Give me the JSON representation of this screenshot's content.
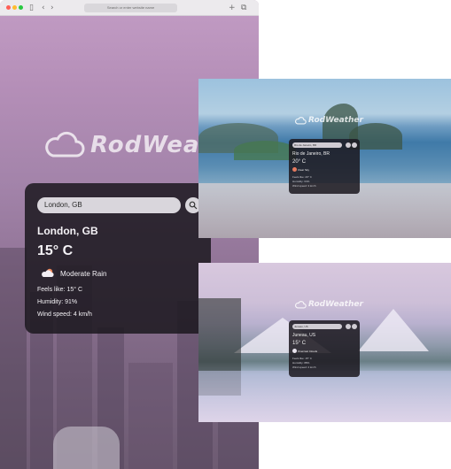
{
  "browser": {
    "url_text": "Search or enter website name",
    "back_icon": "chevron-left-icon",
    "forward_icon": "chevron-right-icon",
    "new_tab_icon": "plus-icon",
    "tabs_icon": "tabs-icon"
  },
  "brand": {
    "name": "RodWeather",
    "logo_icon": "cloud-logo-icon"
  },
  "main_card": {
    "search_value": "London, GB",
    "search_icon": "search-icon",
    "city": "London, GB",
    "temperature": "15° C",
    "description": "Moderate Rain",
    "weather_icon": "sun-cloud-rain-icon",
    "feels_like": "Feels like: 15° C",
    "humidity": "Humidity: 91%",
    "wind": "Wind speed: 4 km/h"
  },
  "rio_card": {
    "brand": "RodWeather",
    "search_value": "Rio de Janeiro, BR",
    "city": "Rio de Janeiro, BR",
    "temperature": "20° C",
    "description": "Clear Sky",
    "feels_like": "Feels like: 20° C",
    "humidity": "Humidity: 64%",
    "wind": "Wind speed: 3 km/h"
  },
  "mountain_card": {
    "brand": "RodWeather",
    "search_value": "Juneau, US",
    "city": "Juneau, US",
    "temperature": "15° C",
    "description": "Overcast Clouds",
    "feels_like": "Feels like: 15° C",
    "humidity": "Humidity: 88%",
    "wind": "Wind speed: 2 km/h"
  },
  "colors": {
    "card_bg": "#1c1820",
    "accent_purple": "#b58fb8",
    "search_bg": "#d9d6dc"
  }
}
